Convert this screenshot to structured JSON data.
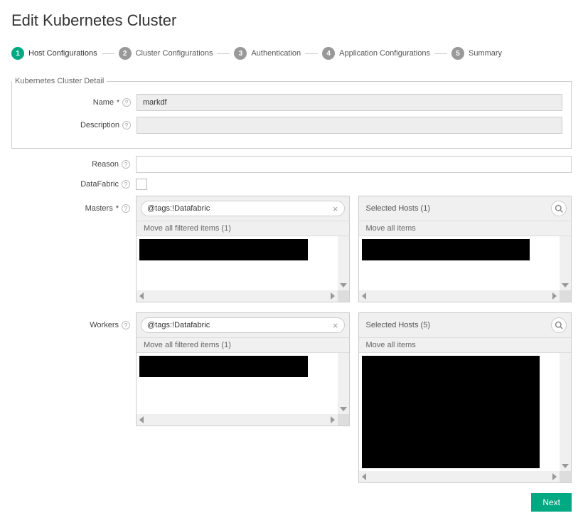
{
  "page_title": "Edit Kubernetes Cluster",
  "stepper": {
    "steps": [
      {
        "num": "1",
        "label": "Host Configurations",
        "active": true
      },
      {
        "num": "2",
        "label": "Cluster Configurations",
        "active": false
      },
      {
        "num": "3",
        "label": "Authentication",
        "active": false
      },
      {
        "num": "4",
        "label": "Application Configurations",
        "active": false
      },
      {
        "num": "5",
        "label": "Summary",
        "active": false
      }
    ]
  },
  "fieldset_legend": "Kubernetes Cluster Detail",
  "fields": {
    "name": {
      "label": "Name",
      "required": "*",
      "value": "markdf"
    },
    "description": {
      "label": "Description",
      "value": ""
    },
    "reason": {
      "label": "Reason",
      "value": ""
    },
    "datafabric": {
      "label": "DataFabric",
      "checked": false
    }
  },
  "masters": {
    "label": "Masters",
    "required": "*",
    "available": {
      "filter_tag": "@tags:!Datafabric",
      "move_text": "Move all filtered items (1)"
    },
    "selected": {
      "header": "Selected Hosts (1)",
      "move_text": "Move all items"
    }
  },
  "workers": {
    "label": "Workers",
    "available": {
      "filter_tag": "@tags:!Datafabric",
      "move_text": "Move all filtered items (1)"
    },
    "selected": {
      "header": "Selected Hosts (5)",
      "move_text": "Move all items"
    }
  },
  "footer": {
    "next": "Next"
  }
}
